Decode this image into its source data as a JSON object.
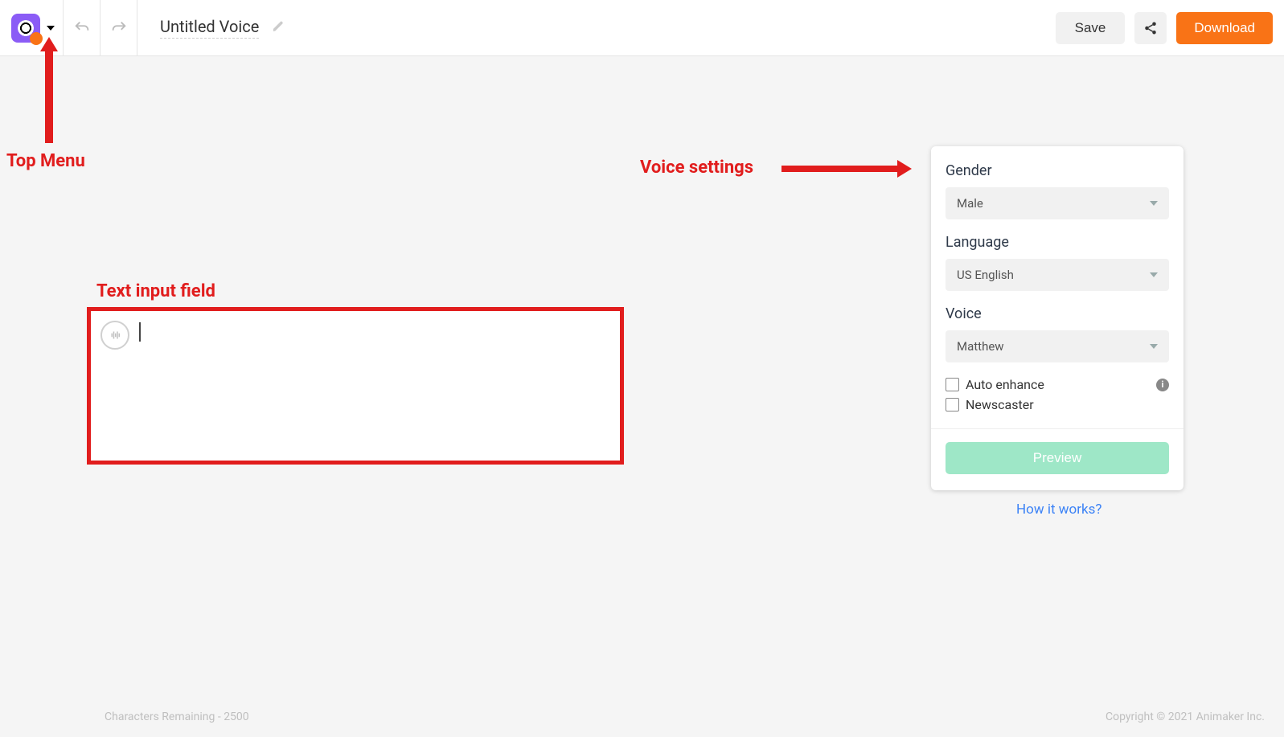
{
  "topbar": {
    "title": "Untitled Voice",
    "save_label": "Save",
    "download_label": "Download"
  },
  "annotations": {
    "top_menu": "Top Menu",
    "text_input": "Text input field",
    "voice_settings": "Voice settings"
  },
  "settings": {
    "gender": {
      "label": "Gender",
      "value": "Male"
    },
    "language": {
      "label": "Language",
      "value": "US English"
    },
    "voice": {
      "label": "Voice",
      "value": "Matthew"
    },
    "auto_enhance_label": "Auto enhance",
    "newscaster_label": "Newscaster",
    "preview_label": "Preview",
    "how_link": "How it works?"
  },
  "footer": {
    "chars_remaining": "Characters Remaining - 2500",
    "copyright": "Copyright © 2021 Animaker Inc."
  }
}
